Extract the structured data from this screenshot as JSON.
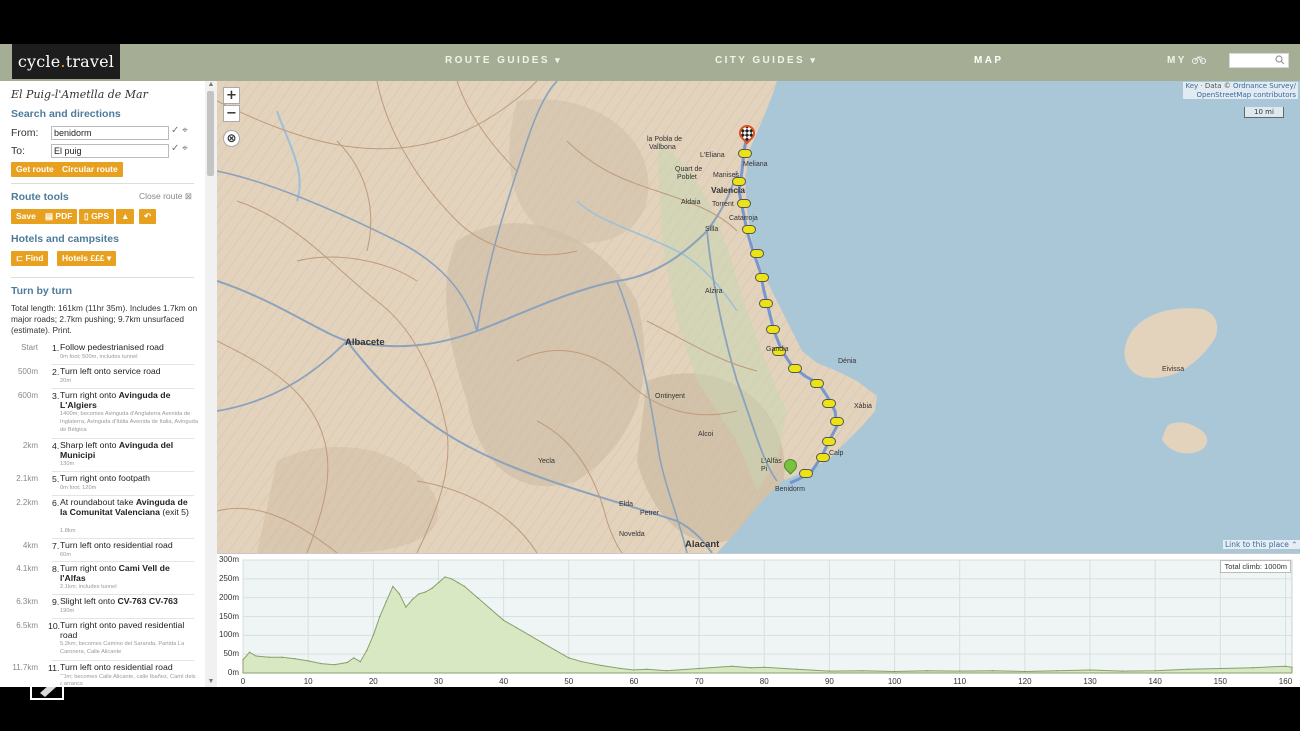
{
  "header": {
    "logo_left": "cycle",
    "logo_dot": ".",
    "logo_right": "travel",
    "nav": [
      {
        "label": "ROUTE GUIDES",
        "caret": "▾"
      },
      {
        "label": "CITY GUIDES",
        "caret": "▾"
      },
      {
        "label": "MAP",
        "caret": ""
      },
      {
        "label": "MY",
        "caret": ""
      }
    ],
    "search_placeholder": ""
  },
  "sidebar": {
    "route_title": "El Puig-l'Ametlla de Mar",
    "search_heading": "Search and directions",
    "from_label": "From:",
    "from_value": "benidorm",
    "to_label": "To:",
    "to_value": "El puig",
    "get_route": "Get route",
    "circular_route": "Circular route",
    "tools_heading": "Route tools",
    "close_route": "Close route",
    "tools": {
      "save": "Save",
      "pdf": "PDF",
      "gps": "GPS"
    },
    "hotels_heading": "Hotels and campsites",
    "find": "Find",
    "hotels": "Hotels £££",
    "turn_heading": "Turn by turn",
    "summary": "Total length: 161km (11hr 35m). Includes 1.7km on major roads; 2.7km pushing; 9.7km unsurfaced (estimate). Print.",
    "steps": [
      {
        "dist": "Start",
        "num": "1.",
        "text": "Follow pedestrianised road",
        "bold": "",
        "sub": "0m foot; 500m, includes tunnel"
      },
      {
        "dist": "500m",
        "num": "2.",
        "text": "Turn left onto service road",
        "bold": "",
        "sub": "20m"
      },
      {
        "dist": "600m",
        "num": "3.",
        "text": "Turn right onto ",
        "bold": "Avinguda de L'Algiers",
        "sub": "1400m; becomes Avinguda d'Anglaterra Avenida de Inglaterra, Avinguda d'Itàlia Avenida de Italia, Avinguda de Bèlgica"
      },
      {
        "dist": "2km",
        "num": "4.",
        "text": "Sharp left onto ",
        "bold": "Avinguda del Municipi",
        "sub": "130m"
      },
      {
        "dist": "2.1km",
        "num": "5.",
        "text": "Turn right onto footpath",
        "bold": "",
        "sub": "0m foot; 120m"
      },
      {
        "dist": "2.2km",
        "num": "6.",
        "text": "At roundabout take ",
        "bold": "Avinguda de la Comunitat Valenciana",
        "extra": " (exit 5)",
        "sub": "1.8km"
      },
      {
        "dist": "4km",
        "num": "7.",
        "text": "Turn left onto residential road",
        "bold": "",
        "sub": "60m"
      },
      {
        "dist": "4.1km",
        "num": "8.",
        "text": "Turn right onto ",
        "bold": "Cami Vell de l'Alfas",
        "sub": "2.1km; includes tunnel"
      },
      {
        "dist": "6.3km",
        "num": "9.",
        "text": "Slight left onto ",
        "bold": "CV-763 CV-763",
        "sub": "190m"
      },
      {
        "dist": "6.5km",
        "num": "10.",
        "text": "Turn right onto paved residential road",
        "bold": "",
        "sub": "5.2km; becomes Camino del Saranda, Partida La Caronera, Calle Alicante"
      },
      {
        "dist": "11.7km",
        "num": "11.",
        "text": "Turn left onto residential road",
        "bold": "",
        "sub": "80m; becomes Calle Alicante, calle Ibañez, Camí dels Barrancs"
      }
    ]
  },
  "map": {
    "attribution_key": "Key",
    "attribution_mid": " · Data © ",
    "attribution_os": "Ordnance Survey/",
    "attribution_osm": "OpenStreetMap contributors",
    "scale": "10 mi",
    "link_place": "Link to this place",
    "zoom_in": "+",
    "zoom_out": "−",
    "labels": [
      {
        "t": "Albacete",
        "cls": "big"
      },
      {
        "t": "Valencia",
        "cls": "med"
      },
      {
        "t": "Alacant",
        "cls": "big"
      },
      {
        "t": "la Pobla de",
        "cls": ""
      },
      {
        "t": "Vallbona",
        "cls": ""
      },
      {
        "t": "L'Eliana",
        "cls": ""
      },
      {
        "t": "Meliana",
        "cls": ""
      },
      {
        "t": "Quart de",
        "cls": ""
      },
      {
        "t": "Poblet",
        "cls": ""
      },
      {
        "t": "Manises",
        "cls": ""
      },
      {
        "t": "Aldaia",
        "cls": ""
      },
      {
        "t": "Torrent",
        "cls": ""
      },
      {
        "t": "Catarroja",
        "cls": ""
      },
      {
        "t": "Silla",
        "cls": ""
      },
      {
        "t": "Alzira",
        "cls": ""
      },
      {
        "t": "Ontinyent",
        "cls": ""
      },
      {
        "t": "Dénia",
        "cls": ""
      },
      {
        "t": "Xàbia",
        "cls": ""
      },
      {
        "t": "Alcoi",
        "cls": ""
      },
      {
        "t": "Yecla",
        "cls": ""
      },
      {
        "t": "L'Alfàs",
        "cls": ""
      },
      {
        "t": "Pi",
        "cls": ""
      },
      {
        "t": "Benidorm",
        "cls": ""
      },
      {
        "t": "Calp",
        "cls": ""
      },
      {
        "t": "Elda",
        "cls": ""
      },
      {
        "t": "Petrer",
        "cls": ""
      },
      {
        "t": "Novelda",
        "cls": ""
      },
      {
        "t": "Eivissa",
        "cls": ""
      },
      {
        "t": "Gandia",
        "cls": ""
      }
    ]
  },
  "elevation": {
    "total_climb": "Total climb: 1000m",
    "y_ticks": [
      "300m",
      "250m",
      "200m",
      "150m",
      "100m",
      "50m",
      "0m"
    ],
    "x_ticks": [
      "0",
      "10",
      "20",
      "30",
      "40",
      "50",
      "60",
      "70",
      "80",
      "90",
      "100",
      "110",
      "120",
      "130",
      "140",
      "150",
      "160"
    ]
  },
  "chart_data": {
    "type": "area",
    "title": "",
    "xlabel": "",
    "ylabel": "",
    "xlim": [
      0,
      161
    ],
    "ylim": [
      0,
      300
    ],
    "grid": true,
    "series": [
      {
        "name": "",
        "x": [
          0,
          1,
          2,
          4,
          6,
          8,
          10,
          12,
          14,
          16,
          17,
          18,
          19,
          20,
          21,
          22,
          23,
          24,
          25,
          26,
          27,
          28,
          29,
          30,
          31,
          32,
          33,
          34,
          36,
          38,
          40,
          42,
          44,
          46,
          48,
          50,
          52,
          55,
          58,
          60,
          62,
          65,
          70,
          75,
          78,
          80,
          85,
          90,
          95,
          100,
          105,
          110,
          115,
          120,
          125,
          130,
          135,
          140,
          145,
          150,
          155,
          160,
          161
        ],
        "y": [
          35,
          55,
          45,
          42,
          42,
          38,
          32,
          25,
          22,
          28,
          40,
          30,
          60,
          100,
          150,
          190,
          230,
          210,
          175,
          195,
          210,
          215,
          225,
          240,
          255,
          250,
          240,
          230,
          200,
          170,
          140,
          120,
          100,
          80,
          60,
          40,
          30,
          20,
          12,
          8,
          10,
          6,
          12,
          18,
          14,
          15,
          10,
          5,
          6,
          4,
          6,
          5,
          6,
          4,
          6,
          8,
          5,
          6,
          10,
          12,
          14,
          18,
          15
        ]
      }
    ]
  }
}
